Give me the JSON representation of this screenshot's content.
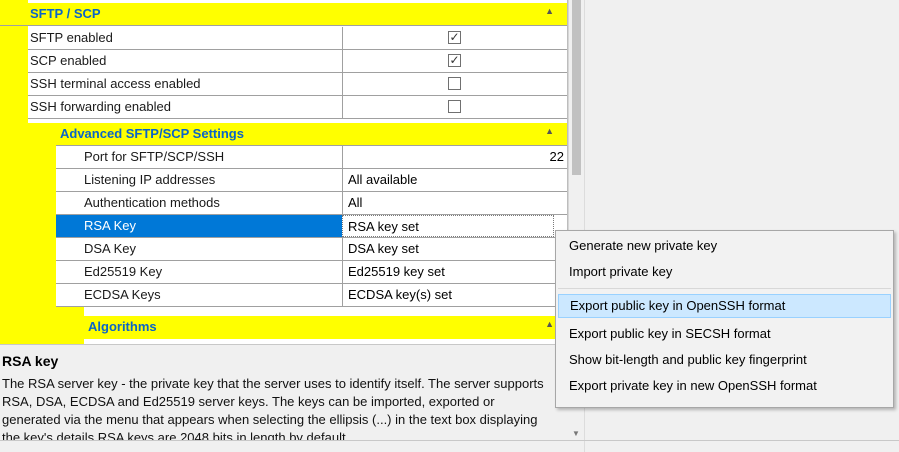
{
  "sections": {
    "sftp_scp": {
      "title": "SFTP / SCP",
      "toggle": "▲"
    },
    "advanced": {
      "title": "Advanced SFTP/SCP Settings",
      "toggle": "▲"
    },
    "algorithms": {
      "title": "Algorithms",
      "toggle": "▲"
    }
  },
  "rows": [
    {
      "name": "SFTP enabled",
      "checked": true,
      "mark": "✓"
    },
    {
      "name": "SCP enabled",
      "checked": true,
      "mark": "✓"
    },
    {
      "name": "SSH terminal access enabled",
      "checked": false,
      "mark": ""
    },
    {
      "name": "SSH forwarding enabled",
      "checked": false,
      "mark": ""
    }
  ],
  "advanced_rows": [
    {
      "name": "Port for SFTP/SCP/SSH",
      "value": "22"
    },
    {
      "name": "Listening IP addresses",
      "value": "All available"
    },
    {
      "name": "Authentication methods",
      "value": "All"
    },
    {
      "name": "RSA Key",
      "value": "RSA key set",
      "selected": true
    },
    {
      "name": "DSA Key",
      "value": "DSA key set"
    },
    {
      "name": "Ed25519 Key",
      "value": "Ed25519 key set"
    },
    {
      "name": "ECDSA Keys",
      "value": "ECDSA key(s) set"
    }
  ],
  "description": {
    "title": "RSA key",
    "text": "The RSA server key -  the private key that the server uses to identify itself. The server supports RSA, DSA, ECDSA and Ed25519 server keys. The keys can be imported, exported or generated via the menu that appears when selecting the ellipsis (...) in the text box displaying the key's details RSA keys are 2048 bits in length by default."
  },
  "context_menu": {
    "items": [
      "Generate new private key",
      "Import private key",
      "Export public key in OpenSSH format",
      "Export public key in SECSH format",
      "Show bit-length and public key fingerprint",
      "Export private key in new OpenSSH format"
    ],
    "highlighted_index": 2
  },
  "colors": {
    "category_bg": "#ffff00",
    "category_text": "#0a64c8",
    "selection": "#0078d7",
    "menu_highlight": "#cce8ff"
  }
}
